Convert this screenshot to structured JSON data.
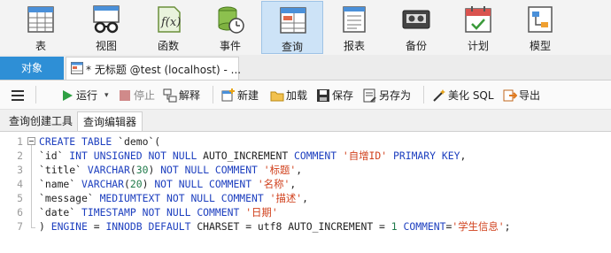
{
  "main_toolbar": {
    "items": [
      {
        "label": "表",
        "icon": "table-icon"
      },
      {
        "label": "视图",
        "icon": "view-glasses-icon"
      },
      {
        "label": "函数",
        "icon": "function-fx-icon"
      },
      {
        "label": "事件",
        "icon": "event-clock-icon"
      },
      {
        "label": "查询",
        "icon": "query-grid-icon",
        "active": true
      },
      {
        "label": "报表",
        "icon": "report-icon"
      },
      {
        "label": "备份",
        "icon": "backup-tape-icon"
      },
      {
        "label": "计划",
        "icon": "calendar-icon"
      },
      {
        "label": "模型",
        "icon": "model-icon"
      }
    ]
  },
  "tabs": {
    "objects_label": "对象",
    "query_tab_title": "* 无标题 @test (localhost) - ..."
  },
  "editor_toolbar": {
    "run": "运行",
    "stop": "停止",
    "explain": "解释",
    "new": "新建",
    "load": "加载",
    "save": "保存",
    "save_as": "另存为",
    "beautify": "美化 SQL",
    "export": "导出"
  },
  "subtabs": {
    "builder": "查询创建工具",
    "editor": "查询编辑器"
  },
  "code_lines": [
    [
      {
        "t": "CREATE TABLE",
        "c": "kw"
      },
      {
        "t": " `demo`(",
        "c": "pl"
      }
    ],
    [
      {
        "t": "`id` ",
        "c": "pl"
      },
      {
        "t": "INT UNSIGNED NOT NULL",
        "c": "kw"
      },
      {
        "t": " AUTO_INCREMENT ",
        "c": "pl"
      },
      {
        "t": "COMMENT",
        "c": "kw"
      },
      {
        "t": " ",
        "c": "pl"
      },
      {
        "t": "'自增ID'",
        "c": "str"
      },
      {
        "t": " ",
        "c": "pl"
      },
      {
        "t": "PRIMARY KEY",
        "c": "kw"
      },
      {
        "t": ",",
        "c": "pl"
      }
    ],
    [
      {
        "t": "`title` ",
        "c": "pl"
      },
      {
        "t": "VARCHAR",
        "c": "kw"
      },
      {
        "t": "(",
        "c": "pl"
      },
      {
        "t": "30",
        "c": "num"
      },
      {
        "t": ") ",
        "c": "pl"
      },
      {
        "t": "NOT NULL COMMENT",
        "c": "kw"
      },
      {
        "t": " ",
        "c": "pl"
      },
      {
        "t": "'标题'",
        "c": "str"
      },
      {
        "t": ",",
        "c": "pl"
      }
    ],
    [
      {
        "t": "`name` ",
        "c": "pl"
      },
      {
        "t": "VARCHAR",
        "c": "kw"
      },
      {
        "t": "(",
        "c": "pl"
      },
      {
        "t": "20",
        "c": "num"
      },
      {
        "t": ") ",
        "c": "pl"
      },
      {
        "t": "NOT NULL COMMENT",
        "c": "kw"
      },
      {
        "t": " ",
        "c": "pl"
      },
      {
        "t": "'名称'",
        "c": "str"
      },
      {
        "t": ",",
        "c": "pl"
      }
    ],
    [
      {
        "t": "`message` ",
        "c": "pl"
      },
      {
        "t": "MEDIUMTEXT NOT NULL COMMENT",
        "c": "kw"
      },
      {
        "t": " ",
        "c": "pl"
      },
      {
        "t": "'描述'",
        "c": "str"
      },
      {
        "t": ",",
        "c": "pl"
      }
    ],
    [
      {
        "t": "`date` ",
        "c": "pl"
      },
      {
        "t": "TIMESTAMP NOT NULL COMMENT",
        "c": "kw"
      },
      {
        "t": " ",
        "c": "pl"
      },
      {
        "t": "'日期'",
        "c": "str"
      }
    ],
    [
      {
        "t": ") ",
        "c": "pl"
      },
      {
        "t": "ENGINE",
        "c": "kw"
      },
      {
        "t": " = ",
        "c": "pl"
      },
      {
        "t": "INNODB DEFAULT",
        "c": "kw"
      },
      {
        "t": " CHARSET = utf8 AUTO_INCREMENT = ",
        "c": "pl"
      },
      {
        "t": "1",
        "c": "num"
      },
      {
        "t": " ",
        "c": "pl"
      },
      {
        "t": "COMMENT",
        "c": "kw"
      },
      {
        "t": "=",
        "c": "pl"
      },
      {
        "t": "'学生信息'",
        "c": "str"
      },
      {
        "t": ";",
        "c": "pl"
      }
    ]
  ],
  "line_numbers": [
    "1",
    "2",
    "3",
    "4",
    "5",
    "6",
    "7"
  ],
  "colors": {
    "keyword": "#1d3fbf",
    "string": "#d0401c",
    "number": "#1f7a4a",
    "accent": "#2e8fd6"
  }
}
